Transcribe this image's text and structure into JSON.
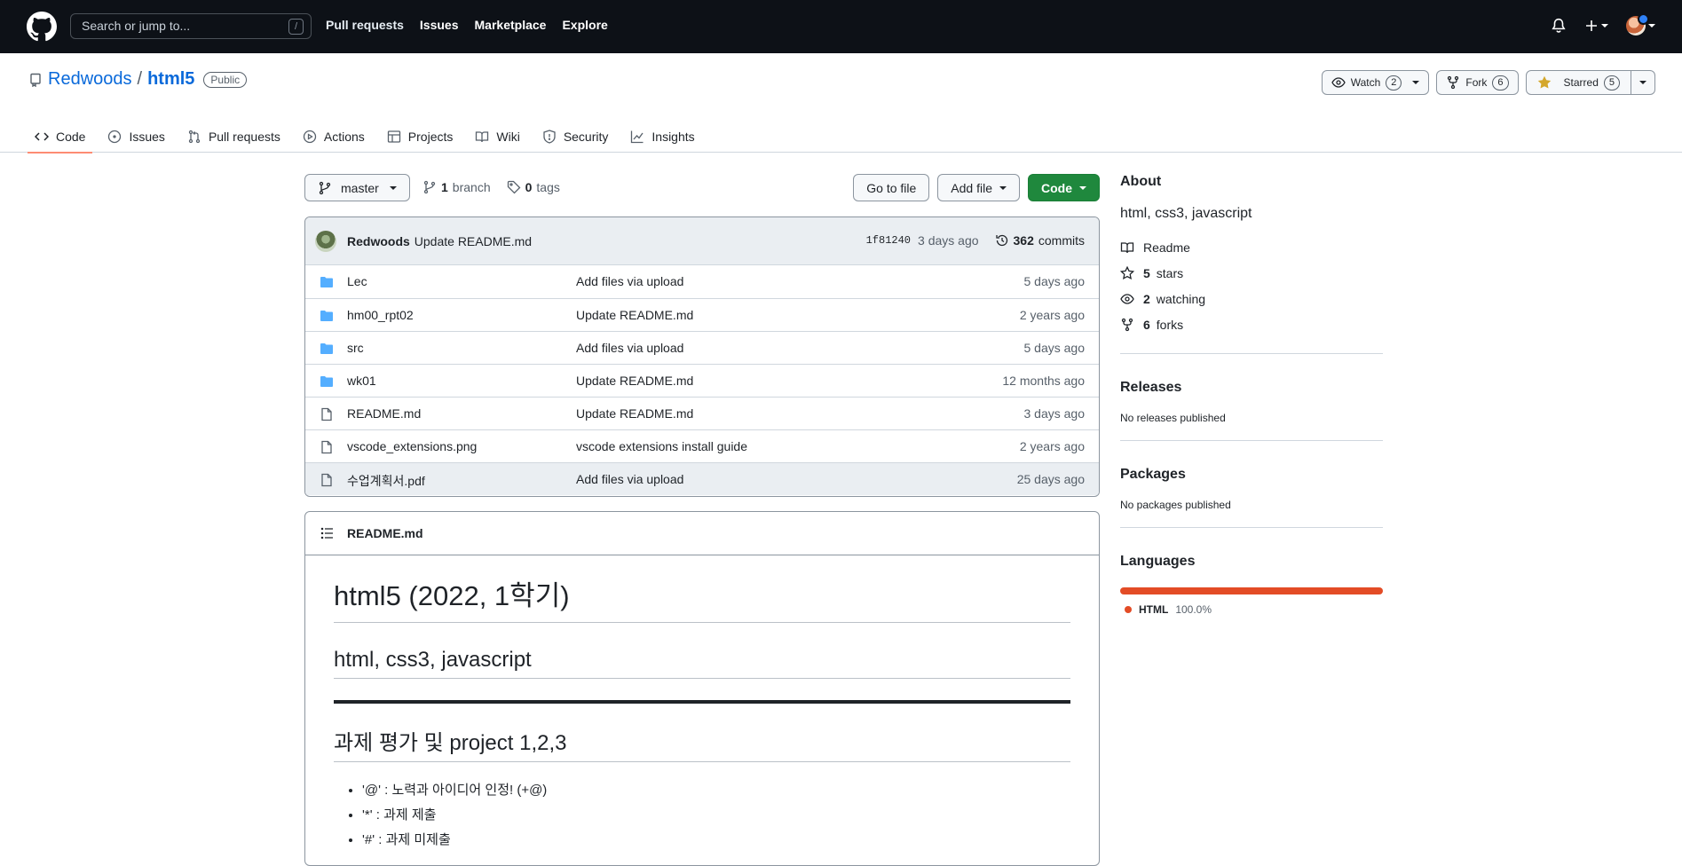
{
  "header": {
    "search_placeholder": "Search or jump to...",
    "search_shortcut": "/",
    "nav": [
      "Pull requests",
      "Issues",
      "Marketplace",
      "Explore"
    ]
  },
  "repo": {
    "owner": "Redwoods",
    "separator": "/",
    "name": "html5",
    "visibility": "Public",
    "watch_label": "Watch",
    "watch_count": "2",
    "fork_label": "Fork",
    "fork_count": "6",
    "star_label": "Starred",
    "star_count": "5"
  },
  "tabs": [
    "Code",
    "Issues",
    "Pull requests",
    "Actions",
    "Projects",
    "Wiki",
    "Security",
    "Insights"
  ],
  "toolbar": {
    "branch": "master",
    "branch_count": "1",
    "branch_label": "branch",
    "tag_count": "0",
    "tag_label": "tags",
    "go_to_file": "Go to file",
    "add_file": "Add file",
    "code": "Code"
  },
  "commit": {
    "author": "Redwoods",
    "message": "Update README.md",
    "sha": "1f81240",
    "age": "3 days ago",
    "count": "362",
    "count_label": "commits"
  },
  "files": [
    {
      "name": "Lec",
      "type": "folder",
      "message": "Add files via upload",
      "age": "5 days ago"
    },
    {
      "name": "hm00_rpt02",
      "type": "folder",
      "message": "Update README.md",
      "age": "2 years ago"
    },
    {
      "name": "src",
      "type": "folder",
      "message": "Add files via upload",
      "age": "5 days ago"
    },
    {
      "name": "wk01",
      "type": "folder",
      "message": "Update README.md",
      "age": "12 months ago"
    },
    {
      "name": "README.md",
      "type": "file",
      "message": "Update README.md",
      "age": "3 days ago"
    },
    {
      "name": "vscode_extensions.png",
      "type": "file",
      "message": "vscode extensions install guide",
      "age": "2 years ago"
    },
    {
      "name": "수업계획서.pdf",
      "type": "file",
      "message": "Add files via upload",
      "age": "25 days ago"
    }
  ],
  "readme": {
    "filename": "README.md",
    "h1": "html5 (2022, 1학기)",
    "h2a": "html, css3, javascript",
    "h2b": "과제 평가 및 project 1,2,3",
    "bullets": [
      "'@' : 노력과 아이디어 인정! (+@)",
      "'*' : 과제 제출",
      "'#' : 과제 미제출"
    ]
  },
  "sidebar": {
    "about_title": "About",
    "description": "html, css3, javascript",
    "readme": "Readme",
    "stars_count": "5",
    "stars_label": "stars",
    "watching_count": "2",
    "watching_label": "watching",
    "forks_count": "6",
    "forks_label": "forks",
    "releases_title": "Releases",
    "releases_text": "No releases published",
    "packages_title": "Packages",
    "packages_text": "No packages published",
    "languages_title": "Languages",
    "language_name": "HTML",
    "language_pct": "100.0%",
    "language_color": "#e34c26"
  },
  "colors": {
    "accent": "#0969da",
    "header_bg": "#0d1117",
    "code_button": "#1f883d",
    "folder": "#54aeff",
    "tab_underline": "#fd8c73"
  }
}
